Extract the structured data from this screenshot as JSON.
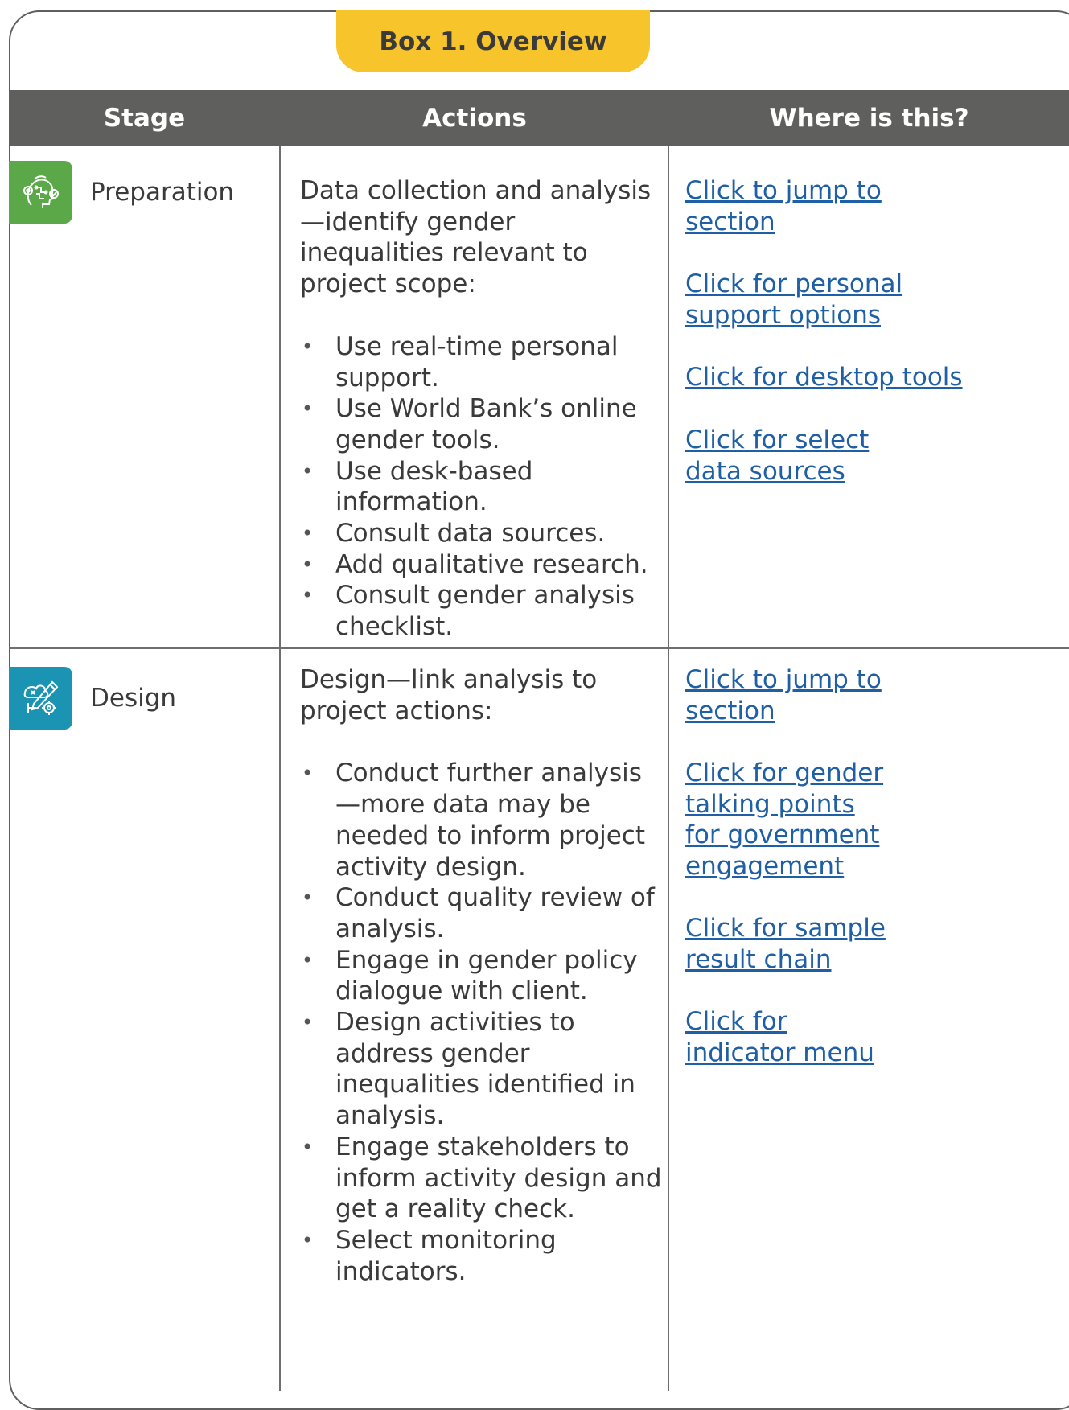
{
  "box_title": "Box 1. Overview",
  "headers": {
    "stage": "Stage",
    "actions": "Actions",
    "where": "Where is this?"
  },
  "rows": [
    {
      "stage": "Preparation",
      "icon": "preparation-gears-head-icon",
      "icon_color": "#5ba849",
      "intro": "Data collection and analysis—identify gender inequalities relevant to project scope:",
      "bullets": [
        "Use real-time personal support.",
        "Use World Bank’s online gender tools.",
        "Use desk-based information.",
        "Consult data sources.",
        "Add qualitative research.",
        "Consult gender analysis checklist."
      ],
      "links": [
        "Click to jump to section",
        "Click for personal support options",
        "Click for desktop tools",
        "Click for select data sources"
      ]
    },
    {
      "stage": "Design",
      "icon": "design-pencil-gears-icon",
      "icon_color": "#1b93b3",
      "intro": "Design—link analysis to project actions:",
      "bullets": [
        "Conduct further analysis—more data may be needed to inform project activity design.",
        "Conduct quality review of analysis.",
        "Engage in gender policy dialogue with client.",
        "Design activities to address gender inequalities identified in analysis.",
        "Engage stakeholders to inform activity design and get a reality check.",
        "Select monitoring indicators."
      ],
      "links": [
        "Click to jump to section",
        "Click for gender talking points for government engagement",
        "Click for sample result chain",
        "Click for indicator menu"
      ]
    }
  ],
  "colors": {
    "accent_yellow": "#f7c42b",
    "header_gray": "#5f5f5e",
    "link_blue": "#1f5fa5"
  }
}
